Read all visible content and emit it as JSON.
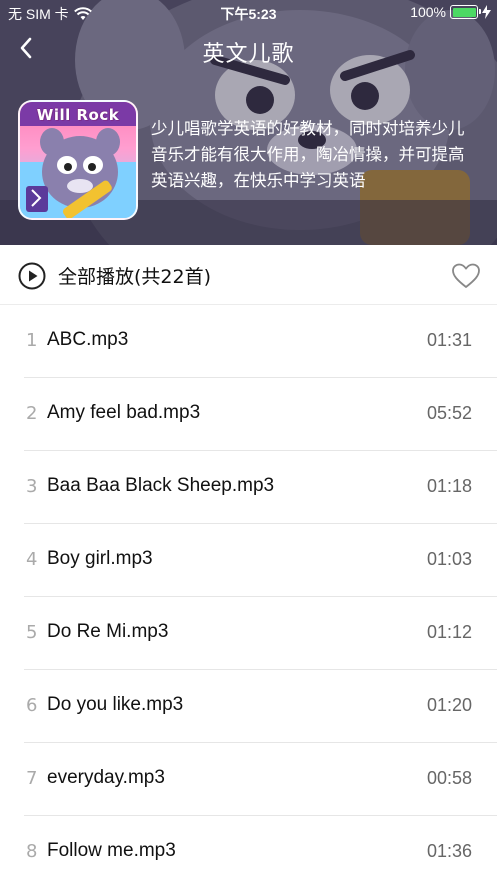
{
  "status_bar": {
    "carrier": "无 SIM 卡",
    "time": "下午5:23",
    "battery": "100%",
    "wifi_icon": "wifi-icon",
    "battery_icon": "battery-icon",
    "charging_icon": "charging-bolt-icon"
  },
  "nav": {
    "title": "英文儿歌",
    "back_icon": "chevron-left-icon"
  },
  "album": {
    "cover_text": "Will Rock",
    "description": "少儿唱歌学英语的好教材，同时对培养少儿音乐才能有很大作用，陶冶情操，并可提高英语兴趣，在快乐中学习英语"
  },
  "playall": {
    "label": "全部播放(共22首)",
    "play_icon": "play-circle-icon",
    "favorite_icon": "heart-outline-icon"
  },
  "songs": [
    {
      "index": "1",
      "title": "ABC.mp3",
      "duration": "01:31"
    },
    {
      "index": "2",
      "title": "Amy feel bad.mp3",
      "duration": "05:52"
    },
    {
      "index": "3",
      "title": "Baa Baa Black Sheep.mp3",
      "duration": "01:18"
    },
    {
      "index": "4",
      "title": "Boy girl.mp3",
      "duration": "01:03"
    },
    {
      "index": "5",
      "title": "Do Re Mi.mp3",
      "duration": "01:12"
    },
    {
      "index": "6",
      "title": "Do you like.mp3",
      "duration": "01:20"
    },
    {
      "index": "7",
      "title": "everyday.mp3",
      "duration": "00:58"
    },
    {
      "index": "8",
      "title": "Follow me.mp3",
      "duration": "01:36"
    }
  ],
  "colors": {
    "header_bg": "#5e5a78",
    "battery_green": "#4cd964",
    "divider": "#e6e6e6",
    "index_gray": "#aaaaaa"
  }
}
